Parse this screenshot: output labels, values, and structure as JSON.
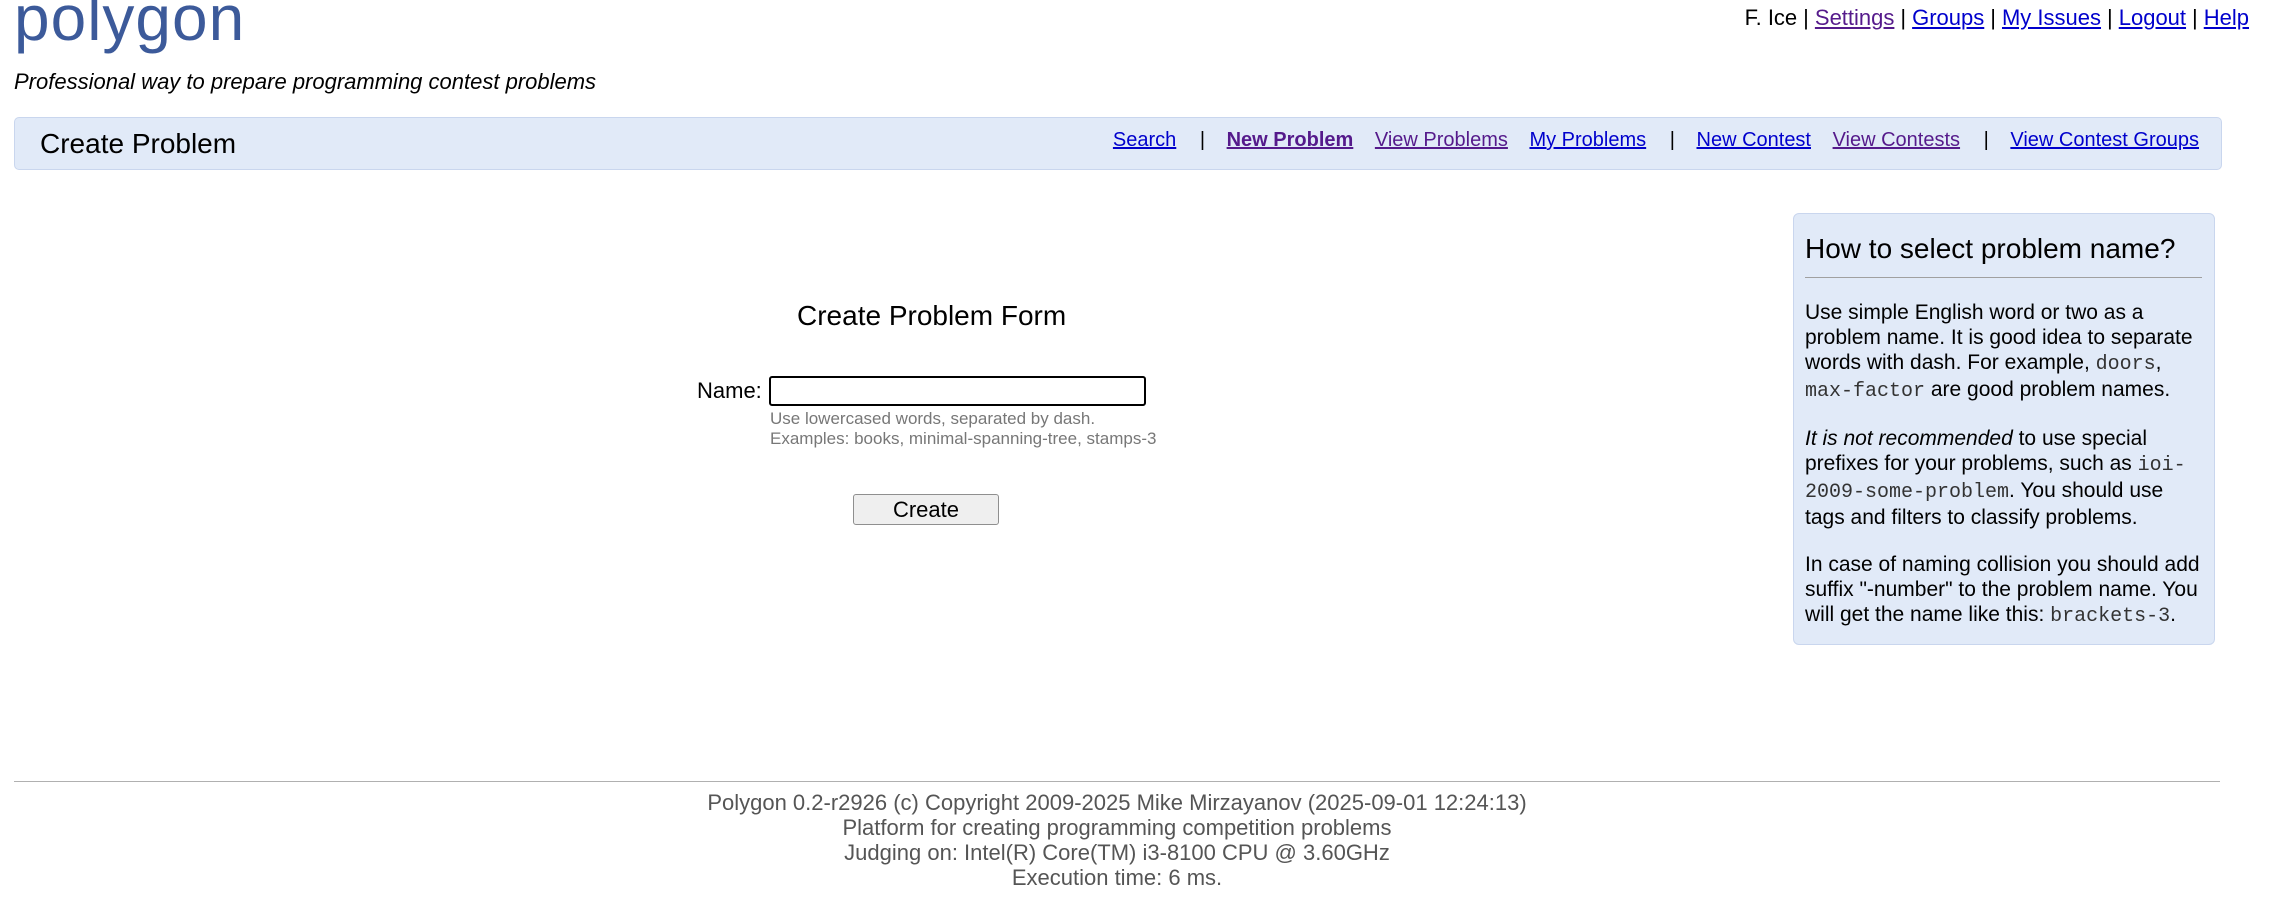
{
  "brand": {
    "logo_text": "polygon",
    "tagline": "Professional way to prepare programming contest problems"
  },
  "user_nav": {
    "user_name": "F. Ice",
    "links": [
      {
        "label": "Settings",
        "visited": true
      },
      {
        "label": "Groups",
        "visited": false
      },
      {
        "label": "My Issues",
        "visited": false
      },
      {
        "label": "Logout",
        "visited": false
      },
      {
        "label": "Help",
        "visited": false
      }
    ]
  },
  "menubar": {
    "title": "Create Problem",
    "search": "Search",
    "new_problem": "New Problem",
    "view_problems": "View Problems",
    "my_problems": "My Problems",
    "new_contest": "New Contest",
    "view_contests": "View Contests",
    "view_contest_groups": "View Contest Groups",
    "separator": "|"
  },
  "form": {
    "title": "Create Problem Form",
    "name_label": "Name:",
    "name_value": "",
    "hint_line1": "Use lowercased words, separated by dash.",
    "hint_line2": "Examples: books, minimal-spanning-tree, stamps-3",
    "submit_label": "Create"
  },
  "sidebar": {
    "heading": "How to select problem name?",
    "p1_a": "Use simple English word or two as a problem name. It is good idea to separate words with dash. For example, ",
    "p1_code1": "doors",
    "p1_b": ", ",
    "p1_code2": "max-factor",
    "p1_c": " are good problem names.",
    "p2_em": "It is not recommended",
    "p2_a": " to use special prefixes for your problems, such as ",
    "p2_code": "ioi-2009-some-problem",
    "p2_b": ". You should use tags and filters to classify problems.",
    "p3_a": "In case of naming collision you should add suffix \"-number\" to the problem name. You will get the name like this: ",
    "p3_code": "brackets-3",
    "p3_b": "."
  },
  "footer": {
    "line1": "Polygon 0.2-r2926 (c) Copyright 2009-2025 Mike Mirzayanov (2025-09-01 12:24:13)",
    "line2": "Platform for creating programming competition problems",
    "line3": "Judging on: Intel(R) Core(TM) i3-8100 CPU @ 3.60GHz",
    "line4": "Execution time: 6 ms."
  },
  "colors": {
    "logo": "#3c5a9a",
    "menubar_bg": "#e1eaf8",
    "link": "#0000cc",
    "visited_link": "#551a8b"
  }
}
